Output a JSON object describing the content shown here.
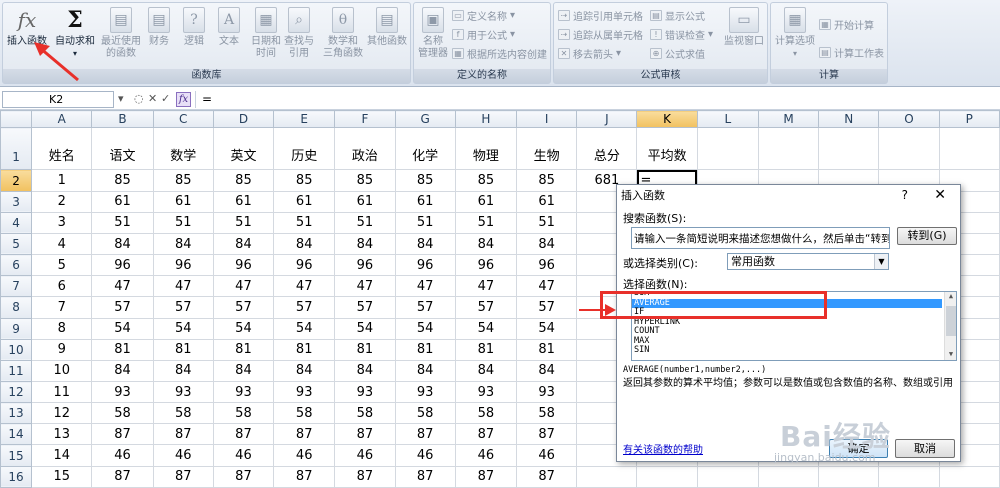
{
  "ribbon": {
    "groups": {
      "library": {
        "label": "函数库"
      },
      "names": {
        "label": "定义的名称"
      },
      "audit": {
        "label": "公式审核"
      },
      "calc": {
        "label": "计算"
      }
    },
    "buttons": {
      "insert_function": {
        "icon": "fx",
        "label": "插入函数"
      },
      "autosum": {
        "icon": "Σ",
        "label": "自动求和"
      },
      "recent": {
        "label1": "最近使用",
        "label2": "的函数"
      },
      "financial": {
        "label": "财务"
      },
      "logical": {
        "label": "逻辑"
      },
      "text": {
        "label": "文本"
      },
      "datetime": {
        "label1": "日期和",
        "label2": "时间"
      },
      "lookup": {
        "label1": "查找与",
        "label2": "引用"
      },
      "math": {
        "label1": "数学和",
        "label2": "三角函数"
      },
      "more": {
        "label": "其他函数"
      },
      "name_manager": {
        "label1": "名称",
        "label2": "管理器"
      },
      "define_name": {
        "label": "定义名称"
      },
      "use_in_formula": {
        "label": "用于公式"
      },
      "create_from_selection": {
        "label": "根据所选内容创建"
      },
      "trace_precedents": {
        "label": "追踪引用单元格"
      },
      "trace_dependents": {
        "label": "追踪从属单元格"
      },
      "remove_arrows": {
        "label": "移去箭头"
      },
      "show_formulas": {
        "label": "显示公式"
      },
      "error_checking": {
        "label": "错误检查"
      },
      "evaluate_formula": {
        "label": "公式求值"
      },
      "watch_window": {
        "label": "监视窗口"
      },
      "calc_options": {
        "label": "计算选项"
      },
      "calc_now": {
        "label": "开始计算"
      },
      "calc_sheet": {
        "label": "计算工作表"
      }
    }
  },
  "formula_bar": {
    "name_box": "K2",
    "fx": "fx",
    "content": "="
  },
  "sheet": {
    "columns": [
      "A",
      "B",
      "C",
      "D",
      "E",
      "F",
      "G",
      "H",
      "I",
      "J",
      "K",
      "L",
      "M",
      "N",
      "O",
      "P"
    ],
    "row_numbers": [
      "1",
      "2",
      "3",
      "4",
      "5",
      "6",
      "7",
      "8",
      "9",
      "10",
      "11",
      "12",
      "13",
      "14",
      "15",
      "16"
    ],
    "headers": [
      "姓名",
      "语文",
      "数学",
      "英文",
      "历史",
      "政治",
      "化学",
      "物理",
      "生物",
      "总分",
      "平均数"
    ],
    "rows": [
      [
        "1",
        "85",
        "85",
        "85",
        "85",
        "85",
        "85",
        "85",
        "85",
        "681",
        "="
      ],
      [
        "2",
        "61",
        "61",
        "61",
        "61",
        "61",
        "61",
        "61",
        "61",
        "",
        ""
      ],
      [
        "3",
        "51",
        "51",
        "51",
        "51",
        "51",
        "51",
        "51",
        "51",
        "",
        ""
      ],
      [
        "4",
        "84",
        "84",
        "84",
        "84",
        "84",
        "84",
        "84",
        "84",
        "",
        ""
      ],
      [
        "5",
        "96",
        "96",
        "96",
        "96",
        "96",
        "96",
        "96",
        "96",
        "",
        ""
      ],
      [
        "6",
        "47",
        "47",
        "47",
        "47",
        "47",
        "47",
        "47",
        "47",
        "",
        ""
      ],
      [
        "7",
        "57",
        "57",
        "57",
        "57",
        "57",
        "57",
        "57",
        "57",
        "",
        ""
      ],
      [
        "8",
        "54",
        "54",
        "54",
        "54",
        "54",
        "54",
        "54",
        "54",
        "",
        ""
      ],
      [
        "9",
        "81",
        "81",
        "81",
        "81",
        "81",
        "81",
        "81",
        "81",
        "",
        ""
      ],
      [
        "10",
        "84",
        "84",
        "84",
        "84",
        "84",
        "84",
        "84",
        "84",
        "",
        ""
      ],
      [
        "11",
        "93",
        "93",
        "93",
        "93",
        "93",
        "93",
        "93",
        "93",
        "",
        ""
      ],
      [
        "12",
        "58",
        "58",
        "58",
        "58",
        "58",
        "58",
        "58",
        "58",
        "",
        ""
      ],
      [
        "13",
        "87",
        "87",
        "87",
        "87",
        "87",
        "87",
        "87",
        "87",
        "",
        ""
      ],
      [
        "14",
        "46",
        "46",
        "46",
        "46",
        "46",
        "46",
        "46",
        "46",
        "",
        ""
      ],
      [
        "15",
        "87",
        "87",
        "87",
        "87",
        "87",
        "87",
        "87",
        "87",
        "",
        ""
      ],
      [
        "16",
        "74",
        "74",
        "74",
        "74",
        "74",
        "74",
        "74",
        "74",
        "",
        ""
      ]
    ]
  },
  "dialog": {
    "title": "插入函数",
    "help": "?",
    "close": "✕",
    "search_label": "搜索函数(S):",
    "search_value": "请输入一条简短说明来描述您想做什么，然后单击“转到”",
    "go_button": "转到(G)",
    "category_label": "或选择类别(C):",
    "category_value": "常用函数",
    "select_label": "选择函数(N):",
    "functions": [
      "SUM",
      "AVERAGE",
      "IF",
      "HYPERLINK",
      "COUNT",
      "MAX",
      "SIN"
    ],
    "selected_function": "AVERAGE",
    "syntax": "AVERAGE(number1,number2,...)",
    "description": "返回其参数的算术平均值；参数可以是数值或包含数值的名称、数组或引用",
    "help_link": "有关该函数的帮助",
    "ok_button": "确定",
    "cancel_button": "取消"
  },
  "watermark": {
    "text": "Bai经验",
    "sub": "jingyan.baidu.com"
  },
  "colors": {
    "annotation": "#e8302a",
    "selection": "#3399ff",
    "header_selected": "#f1c15f"
  }
}
